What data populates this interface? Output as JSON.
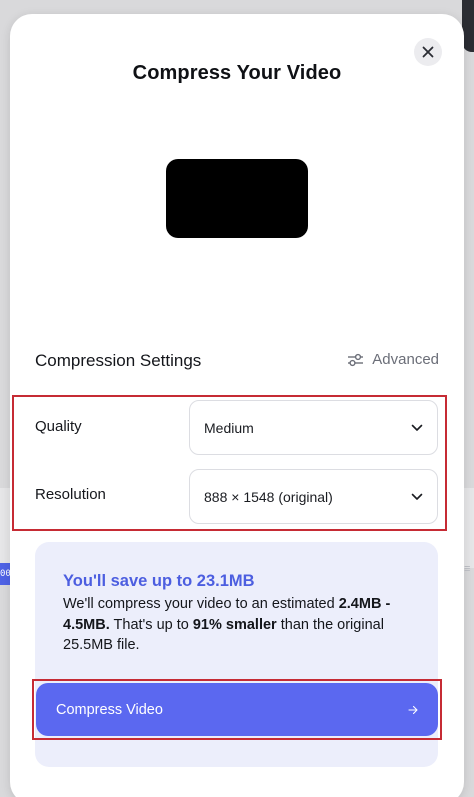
{
  "background": {
    "left_badge_text": "00"
  },
  "modal": {
    "title": "Compress Your Video",
    "close_label": "×"
  },
  "settings": {
    "heading": "Compression Settings",
    "advanced_label": "Advanced",
    "quality": {
      "label": "Quality",
      "selected": "Medium"
    },
    "resolution": {
      "label": "Resolution",
      "selected": "888 × 1548 (original)"
    }
  },
  "savings": {
    "headline": "You'll save up to 23.1MB",
    "line_prefix": "We'll compress your video to an estimated ",
    "estimate": "2.4MB - 4.5MB.",
    "mid_text": " That's up to ",
    "percent": "91% smaller",
    "suffix": " than the original 25.5MB file."
  },
  "action": {
    "compress_label": "Compress Video"
  },
  "colors": {
    "accent": "#5b68f0",
    "headline": "#4c5ee0",
    "highlight": "#c62b34",
    "card_bg": "#eceefb"
  },
  "icons": {
    "close": "close-icon",
    "advanced": "sliders-icon",
    "dropdown": "chevron-down-icon",
    "submit": "arrow-right-icon"
  }
}
